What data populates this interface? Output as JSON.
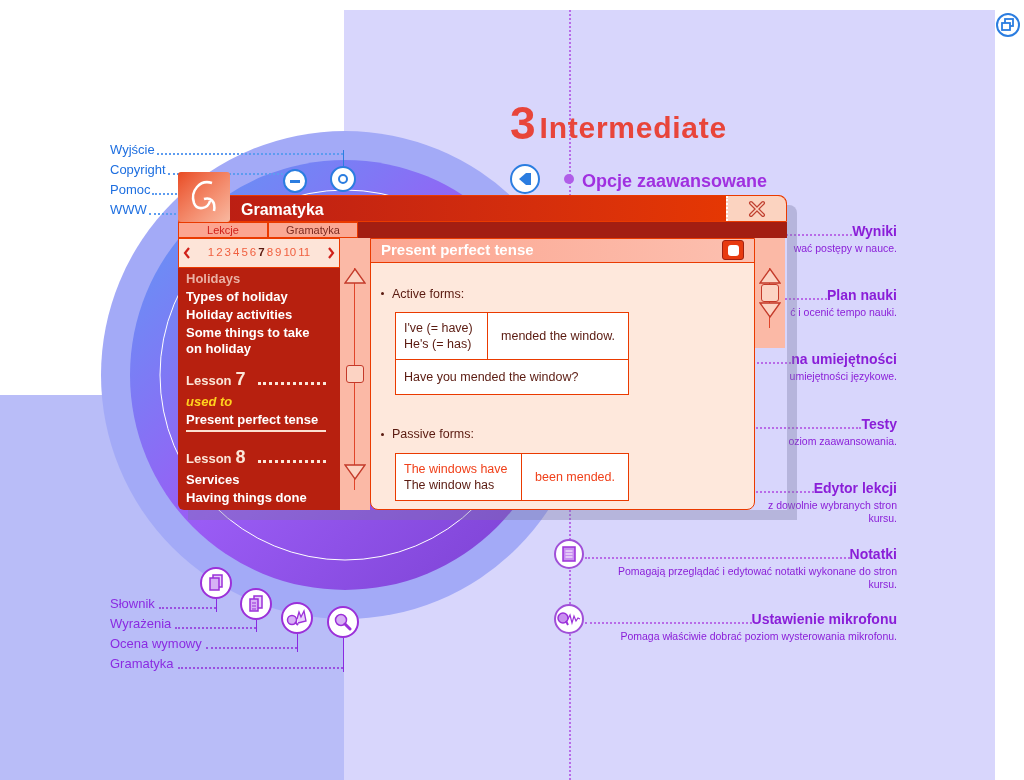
{
  "heading": {
    "number": "3",
    "title": "Intermediate"
  },
  "section_title": "Opcje zaawansowane",
  "top_links": [
    {
      "label": "Wyjście"
    },
    {
      "label": "Copyright"
    },
    {
      "label": "Pomoc"
    },
    {
      "label": "WWW"
    }
  ],
  "tools": [
    {
      "label": "Słownik",
      "kind": "dictionary"
    },
    {
      "label": "Wyrażenia",
      "kind": "phrases"
    },
    {
      "label": "Ocena wymowy",
      "kind": "pronunciation"
    },
    {
      "label": "Gramatyka",
      "kind": "grammar"
    }
  ],
  "options": [
    {
      "kind": "text",
      "title": "Wyniki",
      "description": [
        "wać postępy w nauce."
      ]
    },
    {
      "kind": "text",
      "title": "Plan nauki",
      "description": [
        "ć i ocenić tempo nauki."
      ]
    },
    {
      "kind": "text",
      "title": "na umiejętności",
      "description": [
        "umiejętności językowe."
      ]
    },
    {
      "kind": "text",
      "title": "Testy",
      "description": [
        "oziom zaawansowania."
      ]
    },
    {
      "kind": "text",
      "title": "Edytor lekcji",
      "description": [
        "z dowolnie wybranych stron",
        "kursu."
      ]
    },
    {
      "kind": "notes",
      "title": "Notatki",
      "description": [
        "Pomagają przeglądać i edytować notatki wykonane do stron",
        "kursu."
      ]
    },
    {
      "kind": "microphone",
      "title": "Ustawienie mikrofonu",
      "description": [
        "Pomaga właściwie dobrać poziom wysterowania mikrofonu."
      ]
    }
  ],
  "dialog": {
    "title": "Gramatyka",
    "tabs": [
      {
        "label": "Lekcje",
        "selected": true
      },
      {
        "label": "Gramatyka",
        "selected": false
      }
    ],
    "lesson_numbers": [
      {
        "label": "1",
        "selected": false
      },
      {
        "label": "2",
        "selected": false
      },
      {
        "label": "3",
        "selected": false
      },
      {
        "label": "4",
        "selected": false
      },
      {
        "label": "5",
        "selected": false
      },
      {
        "label": "6",
        "selected": false
      },
      {
        "label": "7",
        "selected": true
      },
      {
        "label": "8",
        "selected": false
      },
      {
        "label": "9",
        "selected": false
      },
      {
        "label": "10",
        "selected": false
      },
      {
        "label": "11",
        "selected": false
      }
    ],
    "lessons": [
      {
        "kind": "topic",
        "label": "Holidays",
        "selected": false
      },
      {
        "kind": "topic",
        "label": "Types of holiday",
        "selected": false
      },
      {
        "kind": "topic",
        "label": "Holiday activities",
        "selected": false
      },
      {
        "kind": "topic",
        "label": "Some things to take on holiday",
        "selected": false
      },
      {
        "kind": "lesson",
        "label": "Lesson",
        "number": "7"
      },
      {
        "kind": "grammar",
        "label": "used to",
        "selected": false
      },
      {
        "kind": "topic",
        "label": "Present perfect tense",
        "selected": true
      },
      {
        "kind": "lesson",
        "label": "Lesson",
        "number": "8"
      },
      {
        "kind": "topic",
        "label": "Services",
        "selected": false
      },
      {
        "kind": "topic",
        "label": "Having things done",
        "selected": false
      }
    ],
    "content": {
      "title": "Present perfect tense",
      "sections": [
        {
          "label": "Active forms:",
          "rows": [
            {
              "cells": [
                {
                  "lines": [
                    {
                      "text": "I've (= have)",
                      "highlight": false
                    },
                    {
                      "text": "He's (= has)",
                      "highlight": false
                    }
                  ]
                },
                {
                  "lines": [
                    {
                      "text": "mended the window.",
                      "highlight": false
                    }
                  ]
                }
              ]
            },
            {
              "cells": [
                {
                  "lines": [
                    {
                      "text": "Have you mended the window?",
                      "highlight": false
                    }
                  ]
                }
              ]
            }
          ]
        },
        {
          "label": "Passive forms:",
          "rows": [
            {
              "cells": [
                {
                  "lines": [
                    {
                      "text": "The windows have",
                      "highlight": true
                    },
                    {
                      "text": "The window has",
                      "highlight": false
                    }
                  ]
                },
                {
                  "lines": [
                    {
                      "text": "been mended.",
                      "highlight": true
                    }
                  ]
                }
              ]
            }
          ]
        }
      ]
    }
  }
}
